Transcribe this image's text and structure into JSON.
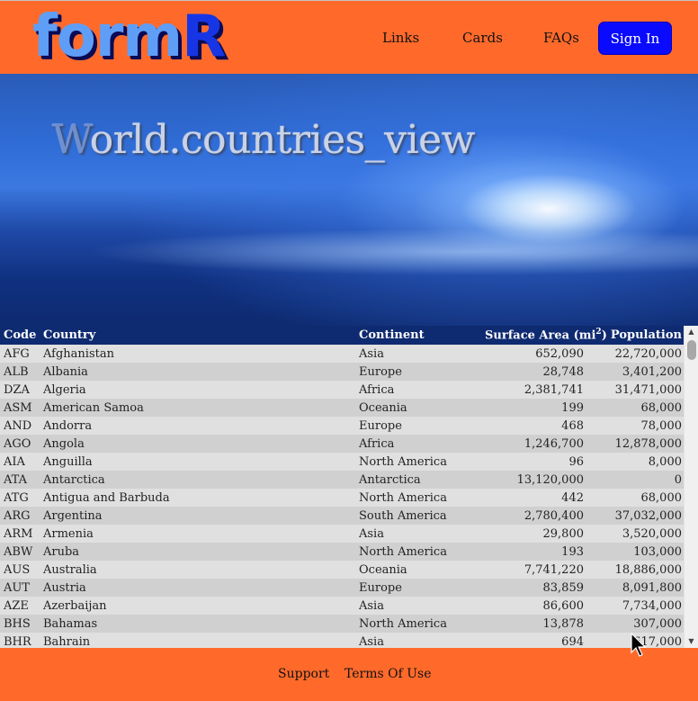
{
  "header": {
    "logo_text": "form",
    "logo_accent": "R",
    "nav": {
      "links": "Links",
      "cards": "Cards",
      "faqs": "FAQs"
    },
    "signin_label": "Sign In"
  },
  "hero": {
    "title_first": "W",
    "title_rest": "orld.countries_view"
  },
  "table": {
    "columns": {
      "code": "Code",
      "country": "Country",
      "continent": "Continent",
      "area": "Surface Area (mi",
      "area_sup": "2",
      "area_close": ")",
      "population": "Population"
    },
    "rows": [
      [
        "AFG",
        "Afghanistan",
        "Asia",
        "652,090",
        "22,720,000"
      ],
      [
        "ALB",
        "Albania",
        "Europe",
        "28,748",
        "3,401,200"
      ],
      [
        "DZA",
        "Algeria",
        "Africa",
        "2,381,741",
        "31,471,000"
      ],
      [
        "ASM",
        "American Samoa",
        "Oceania",
        "199",
        "68,000"
      ],
      [
        "AND",
        "Andorra",
        "Europe",
        "468",
        "78,000"
      ],
      [
        "AGO",
        "Angola",
        "Africa",
        "1,246,700",
        "12,878,000"
      ],
      [
        "AIA",
        "Anguilla",
        "North America",
        "96",
        "8,000"
      ],
      [
        "ATA",
        "Antarctica",
        "Antarctica",
        "13,120,000",
        "0"
      ],
      [
        "ATG",
        "Antigua and Barbuda",
        "North America",
        "442",
        "68,000"
      ],
      [
        "ARG",
        "Argentina",
        "South America",
        "2,780,400",
        "37,032,000"
      ],
      [
        "ARM",
        "Armenia",
        "Asia",
        "29,800",
        "3,520,000"
      ],
      [
        "ABW",
        "Aruba",
        "North America",
        "193",
        "103,000"
      ],
      [
        "AUS",
        "Australia",
        "Oceania",
        "7,741,220",
        "18,886,000"
      ],
      [
        "AUT",
        "Austria",
        "Europe",
        "83,859",
        "8,091,800"
      ],
      [
        "AZE",
        "Azerbaijan",
        "Asia",
        "86,600",
        "7,734,000"
      ],
      [
        "BHS",
        "Bahamas",
        "North America",
        "13,878",
        "307,000"
      ],
      [
        "BHR",
        "Bahrain",
        "Asia",
        "694",
        "617,000"
      ]
    ]
  },
  "footer": {
    "support": "Support",
    "terms": "Terms Of Use"
  },
  "colors": {
    "header_bg": "#ff6a2b",
    "button_bg": "#0a0aff",
    "table_header_bg": "#0e2a70"
  },
  "icons": {
    "scroll_up": "triangle-up-icon",
    "scroll_down": "triangle-down-icon",
    "cursor": "mouse-pointer-icon"
  }
}
